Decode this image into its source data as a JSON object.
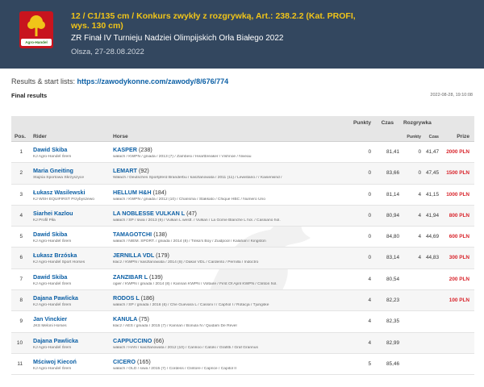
{
  "header": {
    "title": "12 / C1/135 cm / Konkurs zwykły z rozgrywką, Art.: 238.2.2 (Kat. PROFI, wys. 130 cm)",
    "subtitle": "ZR Finał IV Turnieju Nadziei Olimpijskich Orła Białego 2022",
    "place_date": "Olsza, 27-28.08.2022",
    "logo_text": "Agro-Handel"
  },
  "links": {
    "label": "Results & start lists:",
    "url": "https://zawodykonne.com/zawody/8/676/774"
  },
  "section": {
    "title": "Final results",
    "timestamp": "2022-08-28, 19:10:08"
  },
  "table": {
    "headers": {
      "pos": "Pos.",
      "rider": "Rider",
      "horse": "Horse",
      "points": "Punkty",
      "time": "Czas",
      "jumpoff": "Rozgrywka",
      "jo_points": "Punkty",
      "jo_time": "Czas",
      "prize": "Prize"
    },
    "rows": [
      {
        "pos": "1",
        "rider": "Dawid Skiba",
        "club": "KJ Agro-Handel Śrem",
        "horse": "KASPER",
        "horse_no": "(238)",
        "horse_desc": "wałach / KWPN / gniada / 2013 (7) / Zambesi / Heartbreaker / Vishnoe / Niveau",
        "points": "0",
        "time": "81,41",
        "jo_points": "0",
        "jo_time": "41,47",
        "prize": "2000 PLN"
      },
      {
        "pos": "2",
        "rider": "Maria Gneiting",
        "club": "Stajnia Sportowa Skrzyszyce",
        "horse": "LEMART",
        "horse_no": "(92)",
        "horse_desc": "Wałach / Deutsches Sportpferd Branderbu / kasztanowata / 2011 (11) / Lewistano / / Kaiserwind /",
        "points": "0",
        "time": "83,66",
        "jo_points": "0",
        "jo_time": "47,45",
        "prize": "1500 PLN"
      },
      {
        "pos": "3",
        "rider": "Łukasz Wasilewski",
        "club": "KJ WSH EQUIFIRST Przybyszewo",
        "horse": "HELLUM H&H",
        "horse_no": "(184)",
        "horse_desc": "wałach / KWPN / gniada / 2012 (10) / Charisma / Stakkato / Chique HBC / Numero Uno",
        "points": "0",
        "time": "81,14",
        "jo_points": "4",
        "jo_time": "41,15",
        "prize": "1000 PLN"
      },
      {
        "pos": "4",
        "rider": "Siarhei Kazlou",
        "club": "KJ Profil Piła",
        "horse": "LA NOBLESSE VULKAN L",
        "horse_no": "(47)",
        "horse_desc": "wałach / SP / siwa / 2013 (9) / Vulkan L westf. / Vulkan / La Gome Blanche L hol. / Cassiano hol.",
        "points": "0",
        "time": "80,94",
        "jo_points": "4",
        "jo_time": "41,94",
        "prize": "800 PLN"
      },
      {
        "pos": "5",
        "rider": "Dawid Skiba",
        "club": "KJ Agro-Handel Śrem",
        "horse": "TAMAGOTCHI",
        "horse_no": "(138)",
        "horse_desc": "wałach / NIEM. SPORT. / gniada / 2014 (8) / Tinka's Boy / Zuidpool / Kalahari / Kingston",
        "points": "0",
        "time": "84,80",
        "jo_points": "4",
        "jo_time": "44,69",
        "prize": "600 PLN"
      },
      {
        "pos": "6",
        "rider": "Łukasz Brzóska",
        "club": "KJ Agro-Handel Sport Horses",
        "horse": "JERNILLA VDL",
        "horse_no": "(179)",
        "horse_desc": "klacz / KWPN / kasztanowata / 2014 (8) / Dakar VDL / Cardento / Pernilla / Indoctro",
        "points": "0",
        "time": "83,14",
        "jo_points": "4",
        "jo_time": "44,83",
        "prize": "300 PLN"
      },
      {
        "pos": "7",
        "rider": "Dawid Skiba",
        "club": "KJ Agro-Handel Śrem",
        "horse": "ZANZIBAR L",
        "horse_no": "(139)",
        "horse_desc": "ogier / KWPN / gniada / 2014 (8) / Kannan KWPN / Voltaire / First Of April KWPN / Clinton hol.",
        "points": "4",
        "time": "80,54",
        "jo_points": "",
        "jo_time": "",
        "prize": "200 PLN"
      },
      {
        "pos": "8",
        "rider": "Dajana Pawlicka",
        "club": "KJ Agro-Handel Śrem",
        "horse": "RODOS L",
        "horse_no": "(186)",
        "horse_desc": "wałach / SP / gniada / 2016 (6) / Che Guevara L / Cassini I / Caphol I / Rotacja / Tjungske",
        "points": "4",
        "time": "82,23",
        "jo_points": "",
        "jo_time": "",
        "prize": "100 PLN"
      },
      {
        "pos": "9",
        "rider": "Jan Vinckier",
        "club": "JKS Meloni Horses",
        "horse": "KANULA",
        "horse_no": "(75)",
        "horse_desc": "klacz / AES / gniada / 2015 (7) / Kannan / Bonula N / Quidam De Revel",
        "points": "4",
        "time": "82,35",
        "jo_points": "",
        "jo_time": "",
        "prize": ""
      },
      {
        "pos": "10",
        "rider": "Dajana Pawlicka",
        "club": "KJ Agro-Handel Śrem",
        "horse": "CAPPUCCINO",
        "horse_no": "(66)",
        "horse_desc": "wałach / HAN / kasztanowata / 2012 (10) / Canrioo / Catoki / Grafitti / Graf Grannus",
        "points": "4",
        "time": "82,99",
        "jo_points": "",
        "jo_time": "",
        "prize": ""
      },
      {
        "pos": "11",
        "rider": "Mściwoj Kiecoń",
        "club": "KJ Agro-Handel Śrem",
        "horse": "CICERO",
        "horse_no": "(165)",
        "horse_desc": "wałach / OLD / siwa / 2015 (7) / Cordess / Clintore / Caprice / Capitol II",
        "points": "5",
        "time": "85,46",
        "jo_points": "",
        "jo_time": "",
        "prize": ""
      }
    ]
  }
}
